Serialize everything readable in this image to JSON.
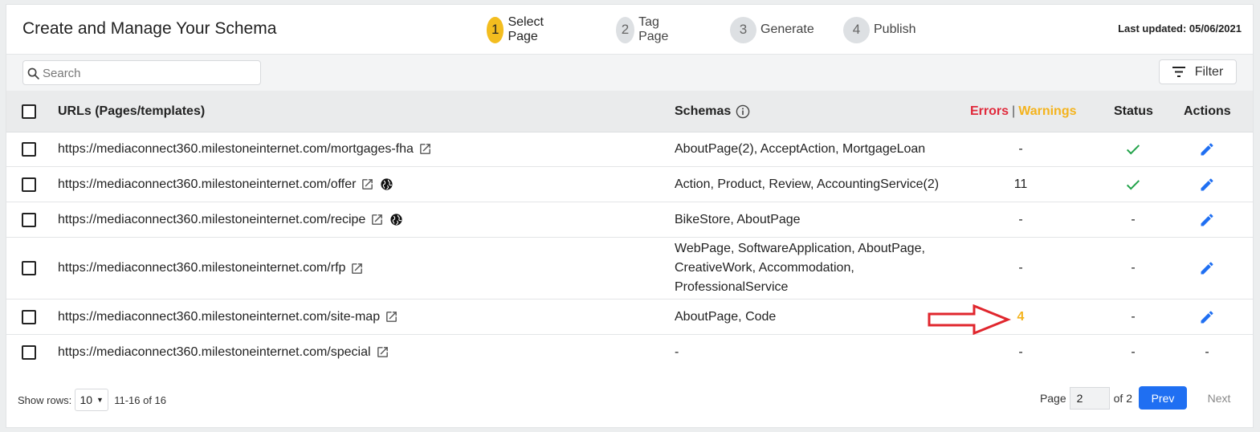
{
  "header": {
    "title": "Create and Manage Your Schema",
    "last_updated": "Last updated: 05/06/2021",
    "steps": [
      {
        "num": "1",
        "label": "Select Page"
      },
      {
        "num": "2",
        "label": "Tag Page"
      },
      {
        "num": "3",
        "label": "Generate"
      },
      {
        "num": "4",
        "label": "Publish"
      }
    ],
    "active_step": 1
  },
  "toolbar": {
    "search_placeholder": "Search",
    "search_value": "",
    "filter_label": "Filter"
  },
  "table": {
    "columns": {
      "urls": "URLs (Pages/templates)",
      "schemas": "Schemas",
      "errors": "Errors",
      "separator": "|",
      "warnings": "Warnings",
      "status": "Status",
      "actions": "Actions"
    },
    "rows": [
      {
        "url": "https://mediaconnect360.milestoneinternet.com/mortgages-fha",
        "globe": false,
        "schemas": "AboutPage(2), AcceptAction, MortgageLoan",
        "count": "-",
        "status": "check",
        "action": "edit"
      },
      {
        "url": "https://mediaconnect360.milestoneinternet.com/offer",
        "globe": true,
        "schemas": "Action, Product, Review, AccountingService(2)",
        "count": "11",
        "status": "check",
        "action": "edit"
      },
      {
        "url": "https://mediaconnect360.milestoneinternet.com/recipe",
        "globe": true,
        "schemas": "BikeStore, AboutPage",
        "count": "-",
        "status": "-",
        "action": "edit"
      },
      {
        "url": "https://mediaconnect360.milestoneinternet.com/rfp",
        "globe": false,
        "schemas_lines": [
          "WebPage, SoftwareApplication, AboutPage,",
          "CreativeWork, Accommodation,",
          "ProfessionalService"
        ],
        "count": "-",
        "status": "-",
        "action": "edit"
      },
      {
        "url": "https://mediaconnect360.milestoneinternet.com/site-map",
        "globe": false,
        "schemas": "AboutPage, Code",
        "count": "4",
        "count_type": "warning",
        "status": "-",
        "action": "edit"
      },
      {
        "url": "https://mediaconnect360.milestoneinternet.com/special",
        "globe": false,
        "schemas": "-",
        "count": "-",
        "status": "-",
        "action": "-"
      }
    ]
  },
  "footer": {
    "show_rows_label": "Show rows:",
    "rows_value": "10",
    "range": "11-16 of 16",
    "page_label": "Page",
    "page_value": "2",
    "of_pages": "of 2",
    "prev_label": "Prev",
    "next_label": "Next"
  },
  "colors": {
    "active_step": "#f3bd1f",
    "errors": "#e0293b",
    "warnings": "#f4b31d",
    "status_ok": "#22a34a",
    "primary": "#1f6ff2",
    "annotation_arrow": "#e0262d"
  },
  "icons": [
    "search-icon",
    "filter-icon",
    "info-icon",
    "external-link-icon",
    "globe-icon",
    "check-icon",
    "edit-pencil-icon",
    "caret-down-icon"
  ]
}
